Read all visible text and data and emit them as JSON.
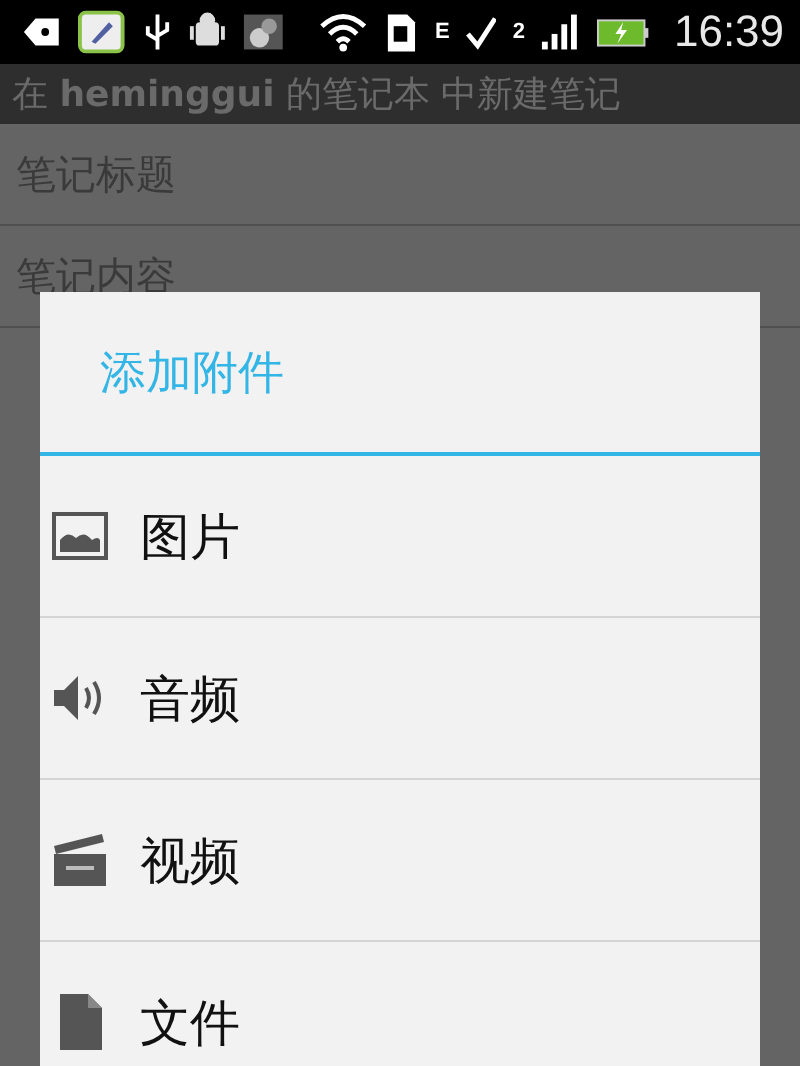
{
  "status_bar": {
    "network_type": "E",
    "sim_slot": "2",
    "time": "16:39"
  },
  "title_bar": {
    "title": "在 **heminggui** 的笔记本 中新建笔记"
  },
  "fields": [
    {
      "placeholder": "笔记标题"
    },
    {
      "placeholder": "笔记内容"
    }
  ],
  "dialog": {
    "title": "添加附件",
    "items": [
      {
        "kind": "image",
        "label": "图片"
      },
      {
        "kind": "audio",
        "label": "音频"
      },
      {
        "kind": "video",
        "label": "视频"
      },
      {
        "kind": "file",
        "label": "文件"
      }
    ]
  }
}
